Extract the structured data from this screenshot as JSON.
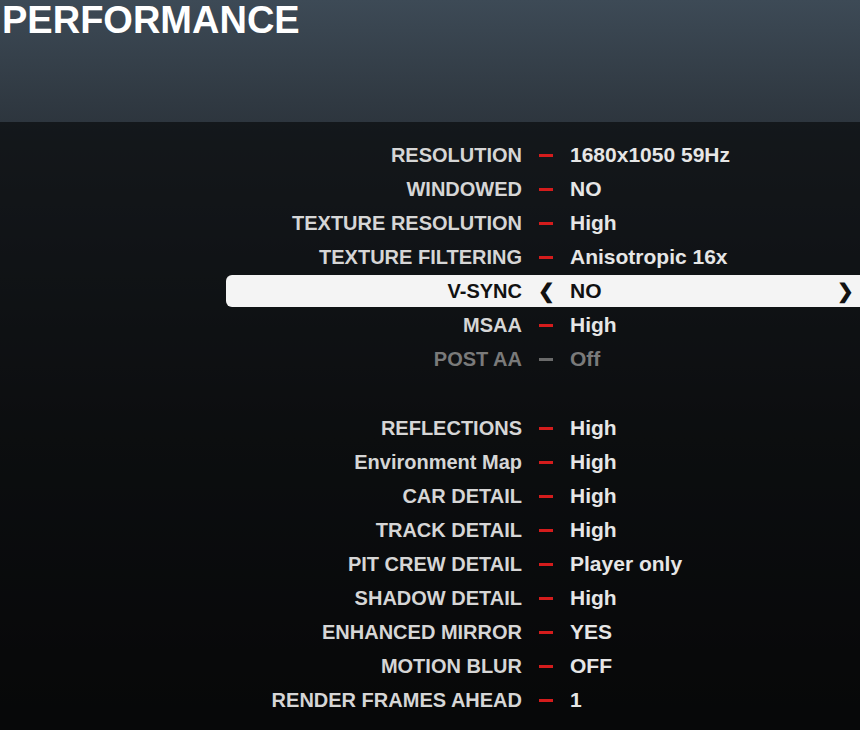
{
  "screen": {
    "title": "PERFORMANCE"
  },
  "arrows": {
    "left": "❮",
    "right": "❯"
  },
  "groups": [
    {
      "settings": [
        {
          "label": "RESOLUTION",
          "value": "1680x1050 59Hz",
          "selected": false,
          "disabled": false
        },
        {
          "label": "WINDOWED",
          "value": "NO",
          "selected": false,
          "disabled": false
        },
        {
          "label": "TEXTURE RESOLUTION",
          "value": "High",
          "selected": false,
          "disabled": false
        },
        {
          "label": "TEXTURE FILTERING",
          "value": "Anisotropic 16x",
          "selected": false,
          "disabled": false
        },
        {
          "label": "V-SYNC",
          "value": "NO",
          "selected": true,
          "disabled": false
        },
        {
          "label": "MSAA",
          "value": "High",
          "selected": false,
          "disabled": false
        },
        {
          "label": "POST AA",
          "value": "Off",
          "selected": false,
          "disabled": true
        }
      ]
    },
    {
      "settings": [
        {
          "label": "REFLECTIONS",
          "value": "High",
          "selected": false,
          "disabled": false
        },
        {
          "label": "Environment Map",
          "value": "High",
          "selected": false,
          "disabled": false
        },
        {
          "label": "CAR DETAIL",
          "value": "High",
          "selected": false,
          "disabled": false
        },
        {
          "label": "TRACK DETAIL",
          "value": "High",
          "selected": false,
          "disabled": false
        },
        {
          "label": "PIT CREW DETAIL",
          "value": "Player only",
          "selected": false,
          "disabled": false
        },
        {
          "label": "SHADOW DETAIL",
          "value": "High",
          "selected": false,
          "disabled": false
        },
        {
          "label": "ENHANCED MIRROR",
          "value": "YES",
          "selected": false,
          "disabled": false
        },
        {
          "label": "MOTION BLUR",
          "value": "OFF",
          "selected": false,
          "disabled": false
        },
        {
          "label": "RENDER FRAMES AHEAD",
          "value": "1",
          "selected": false,
          "disabled": false
        }
      ]
    }
  ]
}
